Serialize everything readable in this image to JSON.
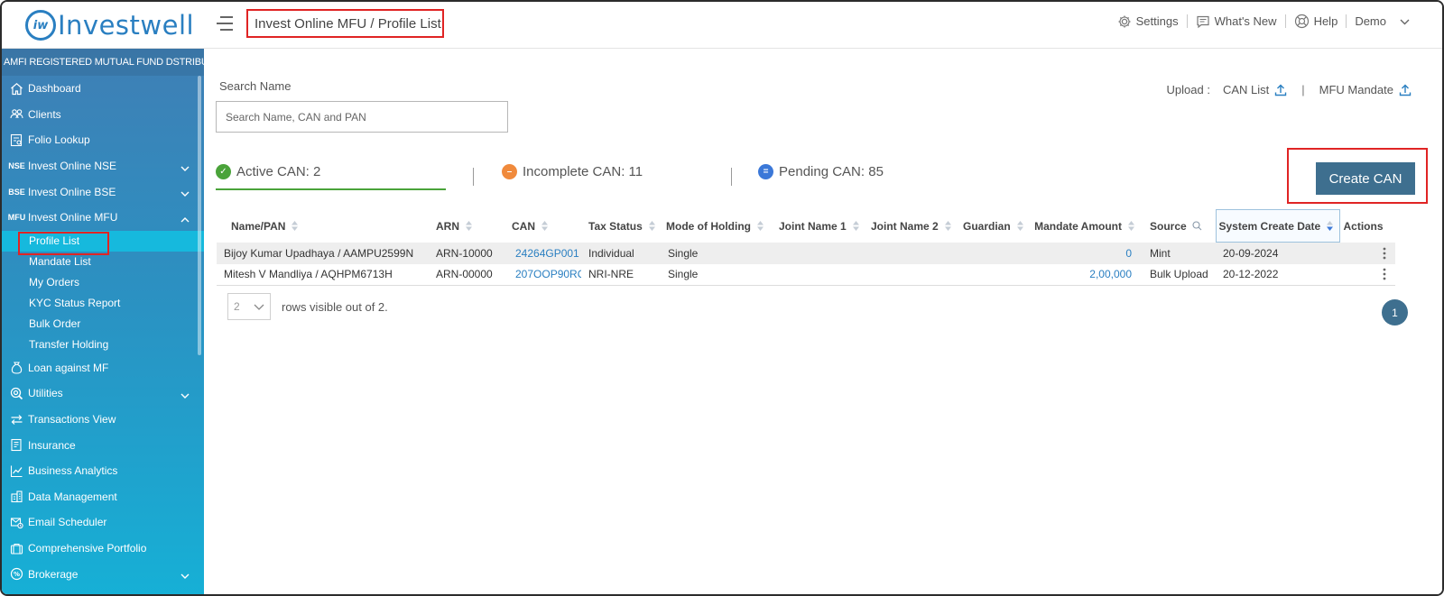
{
  "header": {
    "logo_mark": "iw",
    "logo_text": "Investwell",
    "breadcrumb": "Invest Online MFU / Profile List",
    "settings": "Settings",
    "whats_new": "What's New",
    "help": "Help",
    "user": "Demo"
  },
  "sidebar": {
    "banner": "AMFI REGISTERED MUTUAL FUND DSTRIBUTOR",
    "items": [
      {
        "label": "Dashboard",
        "icon": "home-icon"
      },
      {
        "label": "Clients",
        "icon": "clients-icon"
      },
      {
        "label": "Folio Lookup",
        "icon": "folio-icon"
      },
      {
        "label": "Invest Online NSE",
        "icon": "nse-icon",
        "icon_text": "NSE"
      },
      {
        "label": "Invest Online BSE",
        "icon": "bse-icon",
        "icon_text": "BSE"
      },
      {
        "label": "Invest Online MFU",
        "icon": "mfu-icon",
        "icon_text": "MFU"
      },
      {
        "label": "Loan against MF",
        "icon": "loan-icon"
      },
      {
        "label": "Utilities",
        "icon": "utilities-icon"
      },
      {
        "label": "Transactions View",
        "icon": "transactions-icon"
      },
      {
        "label": "Insurance",
        "icon": "insurance-icon"
      },
      {
        "label": "Business Analytics",
        "icon": "analytics-icon"
      },
      {
        "label": "Data Management",
        "icon": "data-icon"
      },
      {
        "label": "Email Scheduler",
        "icon": "email-icon"
      },
      {
        "label": "Comprehensive Portfolio",
        "icon": "portfolio-icon"
      },
      {
        "label": "Brokerage",
        "icon": "brokerage-icon"
      }
    ],
    "mfu_sub": [
      "Profile List",
      "Mandate List",
      "My Orders",
      "KYC Status Report",
      "Bulk Order",
      "Transfer Holding"
    ]
  },
  "main": {
    "search_label": "Search Name",
    "search_placeholder": "Search Name, CAN and PAN",
    "upload_label": "Upload :",
    "upload_can_list": "CAN List",
    "upload_sep": "|",
    "upload_mfu_mandate": "MFU Mandate",
    "stats": {
      "active": "Active CAN: 2",
      "incomplete": "Incomplete CAN: 11",
      "pending": "Pending CAN: 85"
    },
    "create_button": "Create CAN",
    "columns": [
      "Name/PAN",
      "ARN",
      "CAN",
      "Tax Status",
      "Mode of Holding",
      "Joint Name 1",
      "Joint Name 2",
      "Guardian",
      "Mandate Amount",
      "Source",
      "System Create Date",
      "Actions"
    ],
    "rows": [
      {
        "name": "Bijoy Kumar Upadhaya / AAMPU2599N",
        "arn": "ARN-10000",
        "can": "24264GP001",
        "tax": "Individual",
        "mode": "Single",
        "joint1": "",
        "joint2": "",
        "guardian": "",
        "mandate": "0",
        "source": "Mint",
        "date": "20-09-2024"
      },
      {
        "name": "Mitesh V Mandliya / AQHPM6713H",
        "arn": "ARN-00000",
        "can": "207OOP90RQ",
        "tax": "NRI-NRE",
        "mode": "Single",
        "joint1": "",
        "joint2": "",
        "guardian": "",
        "mandate": "2,00,000",
        "source": "Bulk Upload",
        "date": "20-12-2022"
      }
    ],
    "rows_per_page": "2",
    "rows_text": "rows visible out of 2.",
    "current_page": "1"
  },
  "colors": {
    "brand": "#2a7fc1",
    "button": "#3e6f8f",
    "active_green": "#4aa33a",
    "incomplete_orange": "#f08a3c",
    "pending_blue": "#3b78d8",
    "highlight_red": "#e02424"
  }
}
